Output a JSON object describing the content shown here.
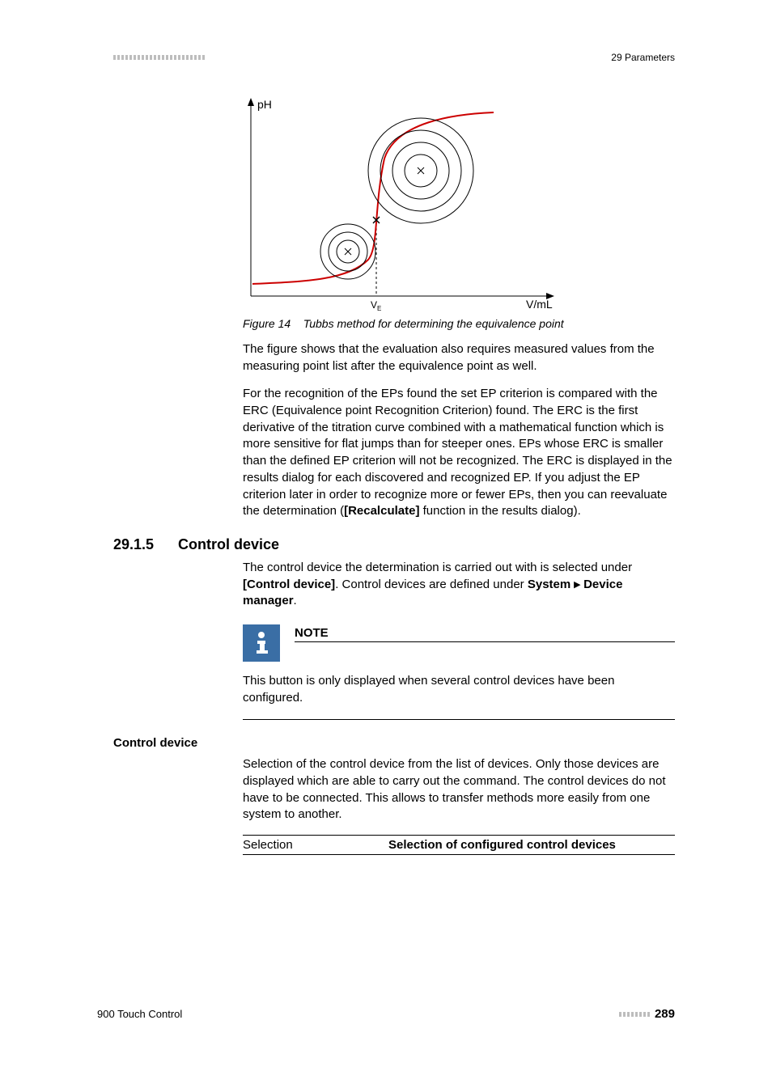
{
  "header": {
    "section": "29 Parameters"
  },
  "chart_data": {
    "type": "line",
    "title": "Tubbs method for determining the equivalence point",
    "xlabel": "V/mL",
    "ylabel": "pH",
    "x_annotation": "V_E",
    "series": [
      {
        "name": "titration-curve",
        "note": "S-shaped titration curve rising steeply near V_E"
      },
      {
        "name": "tubbs-circles",
        "note": "two sets of concentric circles tangent to curve on either side of inflection; smaller below, larger above"
      }
    ]
  },
  "figure": {
    "number": "Figure 14",
    "caption": "Tubbs method for determining the equivalence point"
  },
  "para1": "The figure shows that the evaluation also requires measured values from the measuring point list after the equivalence point as well.",
  "para2a": "For the recognition of the EPs found the set EP criterion is compared with the ERC (Equivalence point Recognition Criterion) found. The ERC is the first derivative of the titration curve combined with a mathematical function which is more sensitive for flat jumps than for steeper ones. EPs whose ERC is smaller than the defined EP criterion will not be recognized. The ERC is displayed in the results dialog for each discovered and recognized EP. If you adjust the EP criterion later in order to recognize more or fewer EPs, then you can reevaluate the determination (",
  "para2_bold": "[Recalculate]",
  "para2b": " function in the results dialog).",
  "section": {
    "number": "29.1.5",
    "title": "Control device"
  },
  "para3a": "The control device the determination is carried out with is selected under ",
  "para3_bold1": "[Control device]",
  "para3b": ". Control devices are defined under ",
  "para3_bold2": "System ▸ Device manager",
  "para3c": ".",
  "note": {
    "title": "NOTE",
    "body": "This button is only displayed when several control devices have been configured."
  },
  "param": {
    "heading": "Control device",
    "body": "Selection of the control device from the list of devices. Only those devices are displayed which are able to carry out the command. The control devices do not have to be connected. This allows to transfer methods more easily from one system to another.",
    "selection_label": "Selection",
    "selection_value": "Selection of configured control devices"
  },
  "footer": {
    "product": "900 Touch Control",
    "page": "289"
  }
}
